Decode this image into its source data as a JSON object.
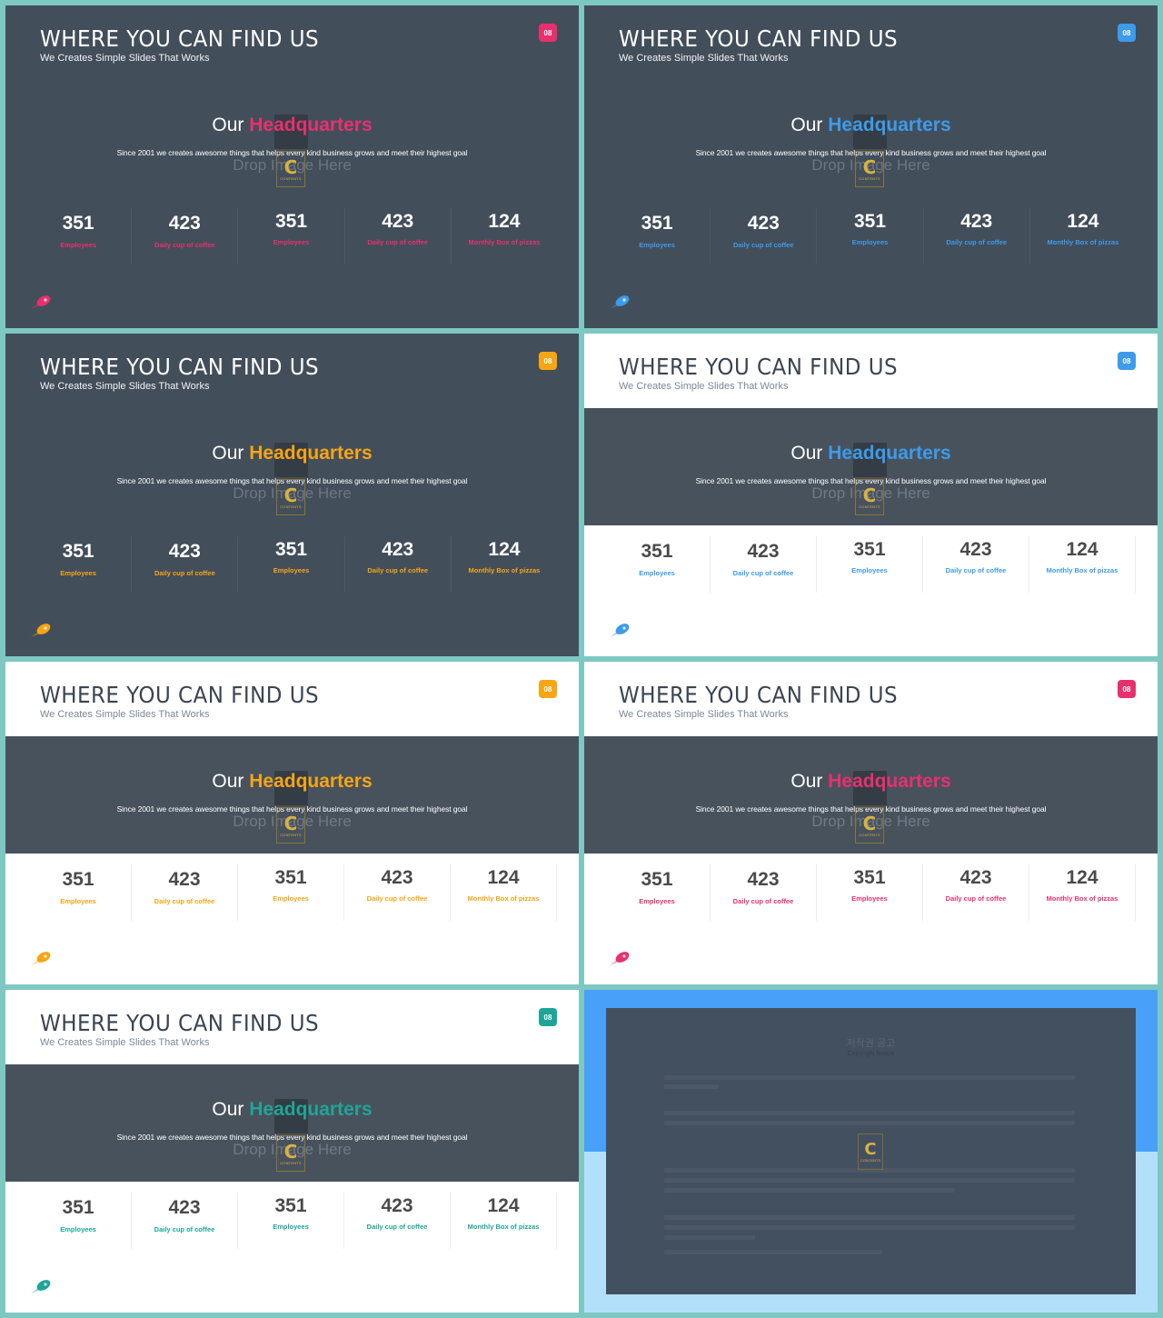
{
  "common": {
    "title": "WHERE YOU CAN FIND US",
    "subtitle": "We Creates Simple Slides That Works",
    "slide_number": "08",
    "hq_prefix": "Our",
    "hq_highlight": "Headquarters",
    "description": "Since 2001 we creates awesome things that helps every kind business grows and meet their highest goal",
    "drop_placeholder": "Drop Image Here",
    "logo_letter": "C",
    "logo_text": "CONTENTS",
    "stats": [
      {
        "value": "351",
        "label": "Employees"
      },
      {
        "value": "423",
        "label": "Daily cup of coffee"
      },
      {
        "value": "351",
        "label": "Employees"
      },
      {
        "value": "423",
        "label": "Daily cup of coffee"
      },
      {
        "value": "124",
        "label": "Monthly Box of pizzas"
      }
    ]
  },
  "slides": [
    {
      "theme": "dark",
      "accent": "#e8306e",
      "accent_name": "pink"
    },
    {
      "theme": "dark",
      "accent": "#3d9be9",
      "accent_name": "blue"
    },
    {
      "theme": "dark",
      "accent": "#f6a515",
      "accent_name": "amber"
    },
    {
      "theme": "light",
      "accent": "#3d9be9",
      "accent_name": "blue"
    },
    {
      "theme": "light",
      "accent": "#f6a515",
      "accent_name": "amber"
    },
    {
      "theme": "light",
      "accent": "#e8306e",
      "accent_name": "pink"
    },
    {
      "theme": "light",
      "accent": "#1fa597",
      "accent_name": "teal"
    }
  ],
  "copyright_slide": {
    "title": "저작권 공고",
    "subtitle": "Copyright Notice",
    "colors": {
      "top": "#48a0f8",
      "bottom": "#b2e0fb",
      "panel": "#435060"
    }
  }
}
